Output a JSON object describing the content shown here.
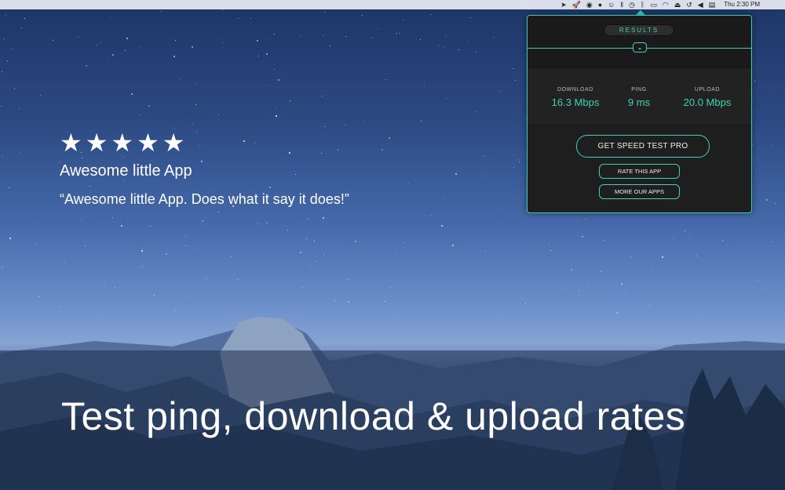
{
  "menubar": {
    "icons": [
      "telegram-icon",
      "rocket-icon",
      "search-badge-icon",
      "spotify-icon",
      "emoji-icon",
      "pause-icon",
      "speedtest-icon",
      "bluetooth-icon",
      "airplay-icon",
      "wifi-icon",
      "eject-icon",
      "time-machine-icon",
      "volume-icon",
      "us-flag-icon"
    ],
    "clock": "Thu 2:30 PM"
  },
  "review": {
    "stars": "★★★★★",
    "rating": 5,
    "title": "Awesome little App",
    "quote": "“Awesome little App. Does what it say it does!”"
  },
  "headline": "Test ping, download & upload rates",
  "panel": {
    "tab_label": "RESULTS",
    "chevron": "⌄",
    "stats": {
      "download_label": "DOWNLOAD",
      "download_value": "16.3 Mbps",
      "ping_label": "PING",
      "ping_value": "9 ms",
      "upload_label": "UPLOAD",
      "upload_value": "20.0 Mbps"
    },
    "buttons": {
      "pro": "GET SPEED TEST PRO",
      "rate": "RATE THIS APP",
      "more": "MORE OUR APPS"
    }
  },
  "colors": {
    "accent": "#3fd1b5",
    "panel_bg": "#1e1e1e",
    "sky_top": "#1d3565"
  }
}
